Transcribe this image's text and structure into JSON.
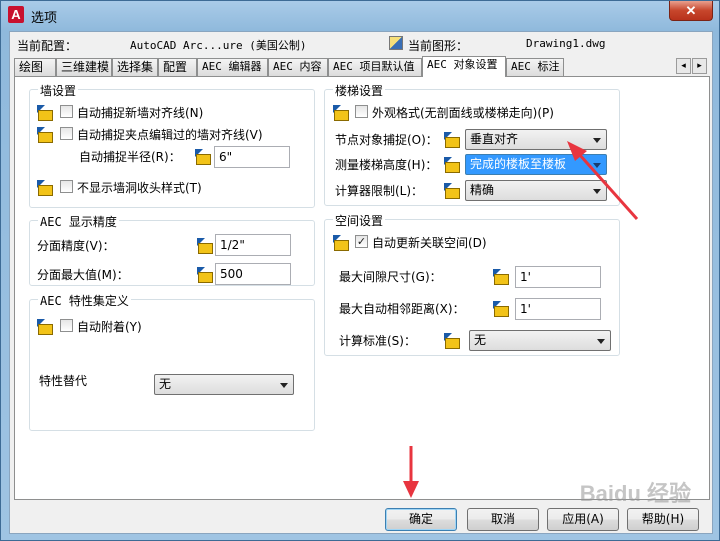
{
  "window": {
    "title": "选项",
    "close_label": "✕"
  },
  "profile": {
    "current_profile_label": "当前配置：",
    "current_profile_value": "AutoCAD Arc...ure (美国公制)",
    "current_drawing_label": "当前图形：",
    "current_drawing_value": "Drawing1.dwg"
  },
  "tabs": [
    {
      "label": "绘图"
    },
    {
      "label": "三维建模"
    },
    {
      "label": "选择集"
    },
    {
      "label": "配置"
    },
    {
      "label": "AEC 编辑器"
    },
    {
      "label": "AEC 内容"
    },
    {
      "label": "AEC 项目默认值"
    },
    {
      "label": "AEC 对象设置",
      "active": true
    },
    {
      "label": "AEC 标注"
    }
  ],
  "tab_scroll": {
    "left": "◂",
    "right": "▸"
  },
  "wall": {
    "title": "墙设置",
    "autosnap_new": {
      "checked": false,
      "label": "自动捕捉新墙对齐线(N)"
    },
    "autosnap_grip": {
      "checked": false,
      "label": "自动捕捉夹点编辑过的墙对齐线(V)"
    },
    "snap_radius_label": "自动捕捉半径(R)：",
    "snap_radius_value": "6\"",
    "no_cleanup": {
      "checked": false,
      "label": "不显示墙洞收头样式(T)"
    }
  },
  "precision": {
    "title": "AEC 显示精度",
    "area_label": "分面精度(V)：",
    "area_value": "1/2\"",
    "max_label": "分面最大值(M)：",
    "max_value": "500"
  },
  "propset": {
    "title": "AEC 特性集定义",
    "auto_attach": {
      "checked": false,
      "label": "自动附着(Y)"
    },
    "override_label": "特性替代",
    "override_value": "无"
  },
  "stair": {
    "title": "楼梯设置",
    "presentation": {
      "checked": false,
      "label": "外观格式(无剖面线或楼梯走向)(P)"
    },
    "node_snap_label": "节点对象捕捉(O)：",
    "node_snap_value": "垂直对齐",
    "measure_label": "测量楼梯高度(H)：",
    "measure_value": "完成的楼板至楼板",
    "calc_label": "计算器限制(L)：",
    "calc_value": "精确"
  },
  "space": {
    "title": "空间设置",
    "auto_update": {
      "checked": true,
      "label": "自动更新关联空间(D)"
    },
    "max_gap_label": "最大间隙尺寸(G)：",
    "max_gap_value": "1'",
    "max_adj_label": "最大自动相邻距离(X)：",
    "max_adj_value": "1'",
    "calc_std_label": "计算标准(S)：",
    "calc_std_value": "无"
  },
  "buttons": {
    "ok": "确定",
    "cancel": "取消",
    "apply": "应用(A)",
    "help": "帮助(H)"
  },
  "colors": {
    "annotation_arrow": "#e8353f",
    "selected": "#3399ff",
    "close": "#c7462c"
  },
  "watermark": "Baidu 经验"
}
